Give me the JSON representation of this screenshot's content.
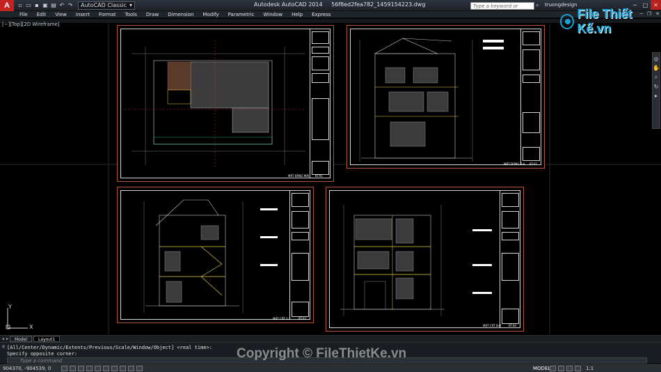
{
  "titlebar": {
    "app_logo": "A",
    "workspace": "AutoCAD Classic",
    "app_title": "Autodesk AutoCAD 2014",
    "file_name": "56f8ed2fea782_1459154223.dwg",
    "search_placeholder": "Type a keyword or phrase",
    "user": "truongdesign"
  },
  "menu": [
    "File",
    "Edit",
    "View",
    "Insert",
    "Format",
    "Tools",
    "Draw",
    "Dimension",
    "Modify",
    "Parametric",
    "Window",
    "Help",
    "Express"
  ],
  "viewport_label": "[−][Top][2D Wireframe]",
  "sheets": {
    "s1": {
      "caption": "MẶT BẰNG MÁI",
      "code": "KT-01"
    },
    "s2": {
      "caption": "MẶT ĐỨNG A-A",
      "code": "KT-02"
    },
    "s3": {
      "caption": "MẶT CẮT 1-1",
      "code": "KT-03"
    },
    "s4": {
      "caption": "MẶT CẮT B-B",
      "code": "KT-04"
    }
  },
  "ucs": {
    "y": "Y",
    "x": "X"
  },
  "tabs": {
    "model": "Model",
    "layout1": "Layout1"
  },
  "command": {
    "history_1": "[All/Center/Dynamic/Extents/Previous/Scale/Window/Object] <real time>:",
    "history_2": "Specify opposite corner:",
    "prompt": "Type a command"
  },
  "status": {
    "coords": "904370, -904539, 0",
    "model": "MODEL",
    "scale": "1:1"
  },
  "watermark": {
    "logo_text": "File Thiết Kế.vn",
    "copyright": "Copyright © FileThietKe.vn"
  },
  "colors": {
    "sheet_frame": "#b0573a",
    "accent_yellow": "#e8d24a",
    "close": "#b82020"
  }
}
